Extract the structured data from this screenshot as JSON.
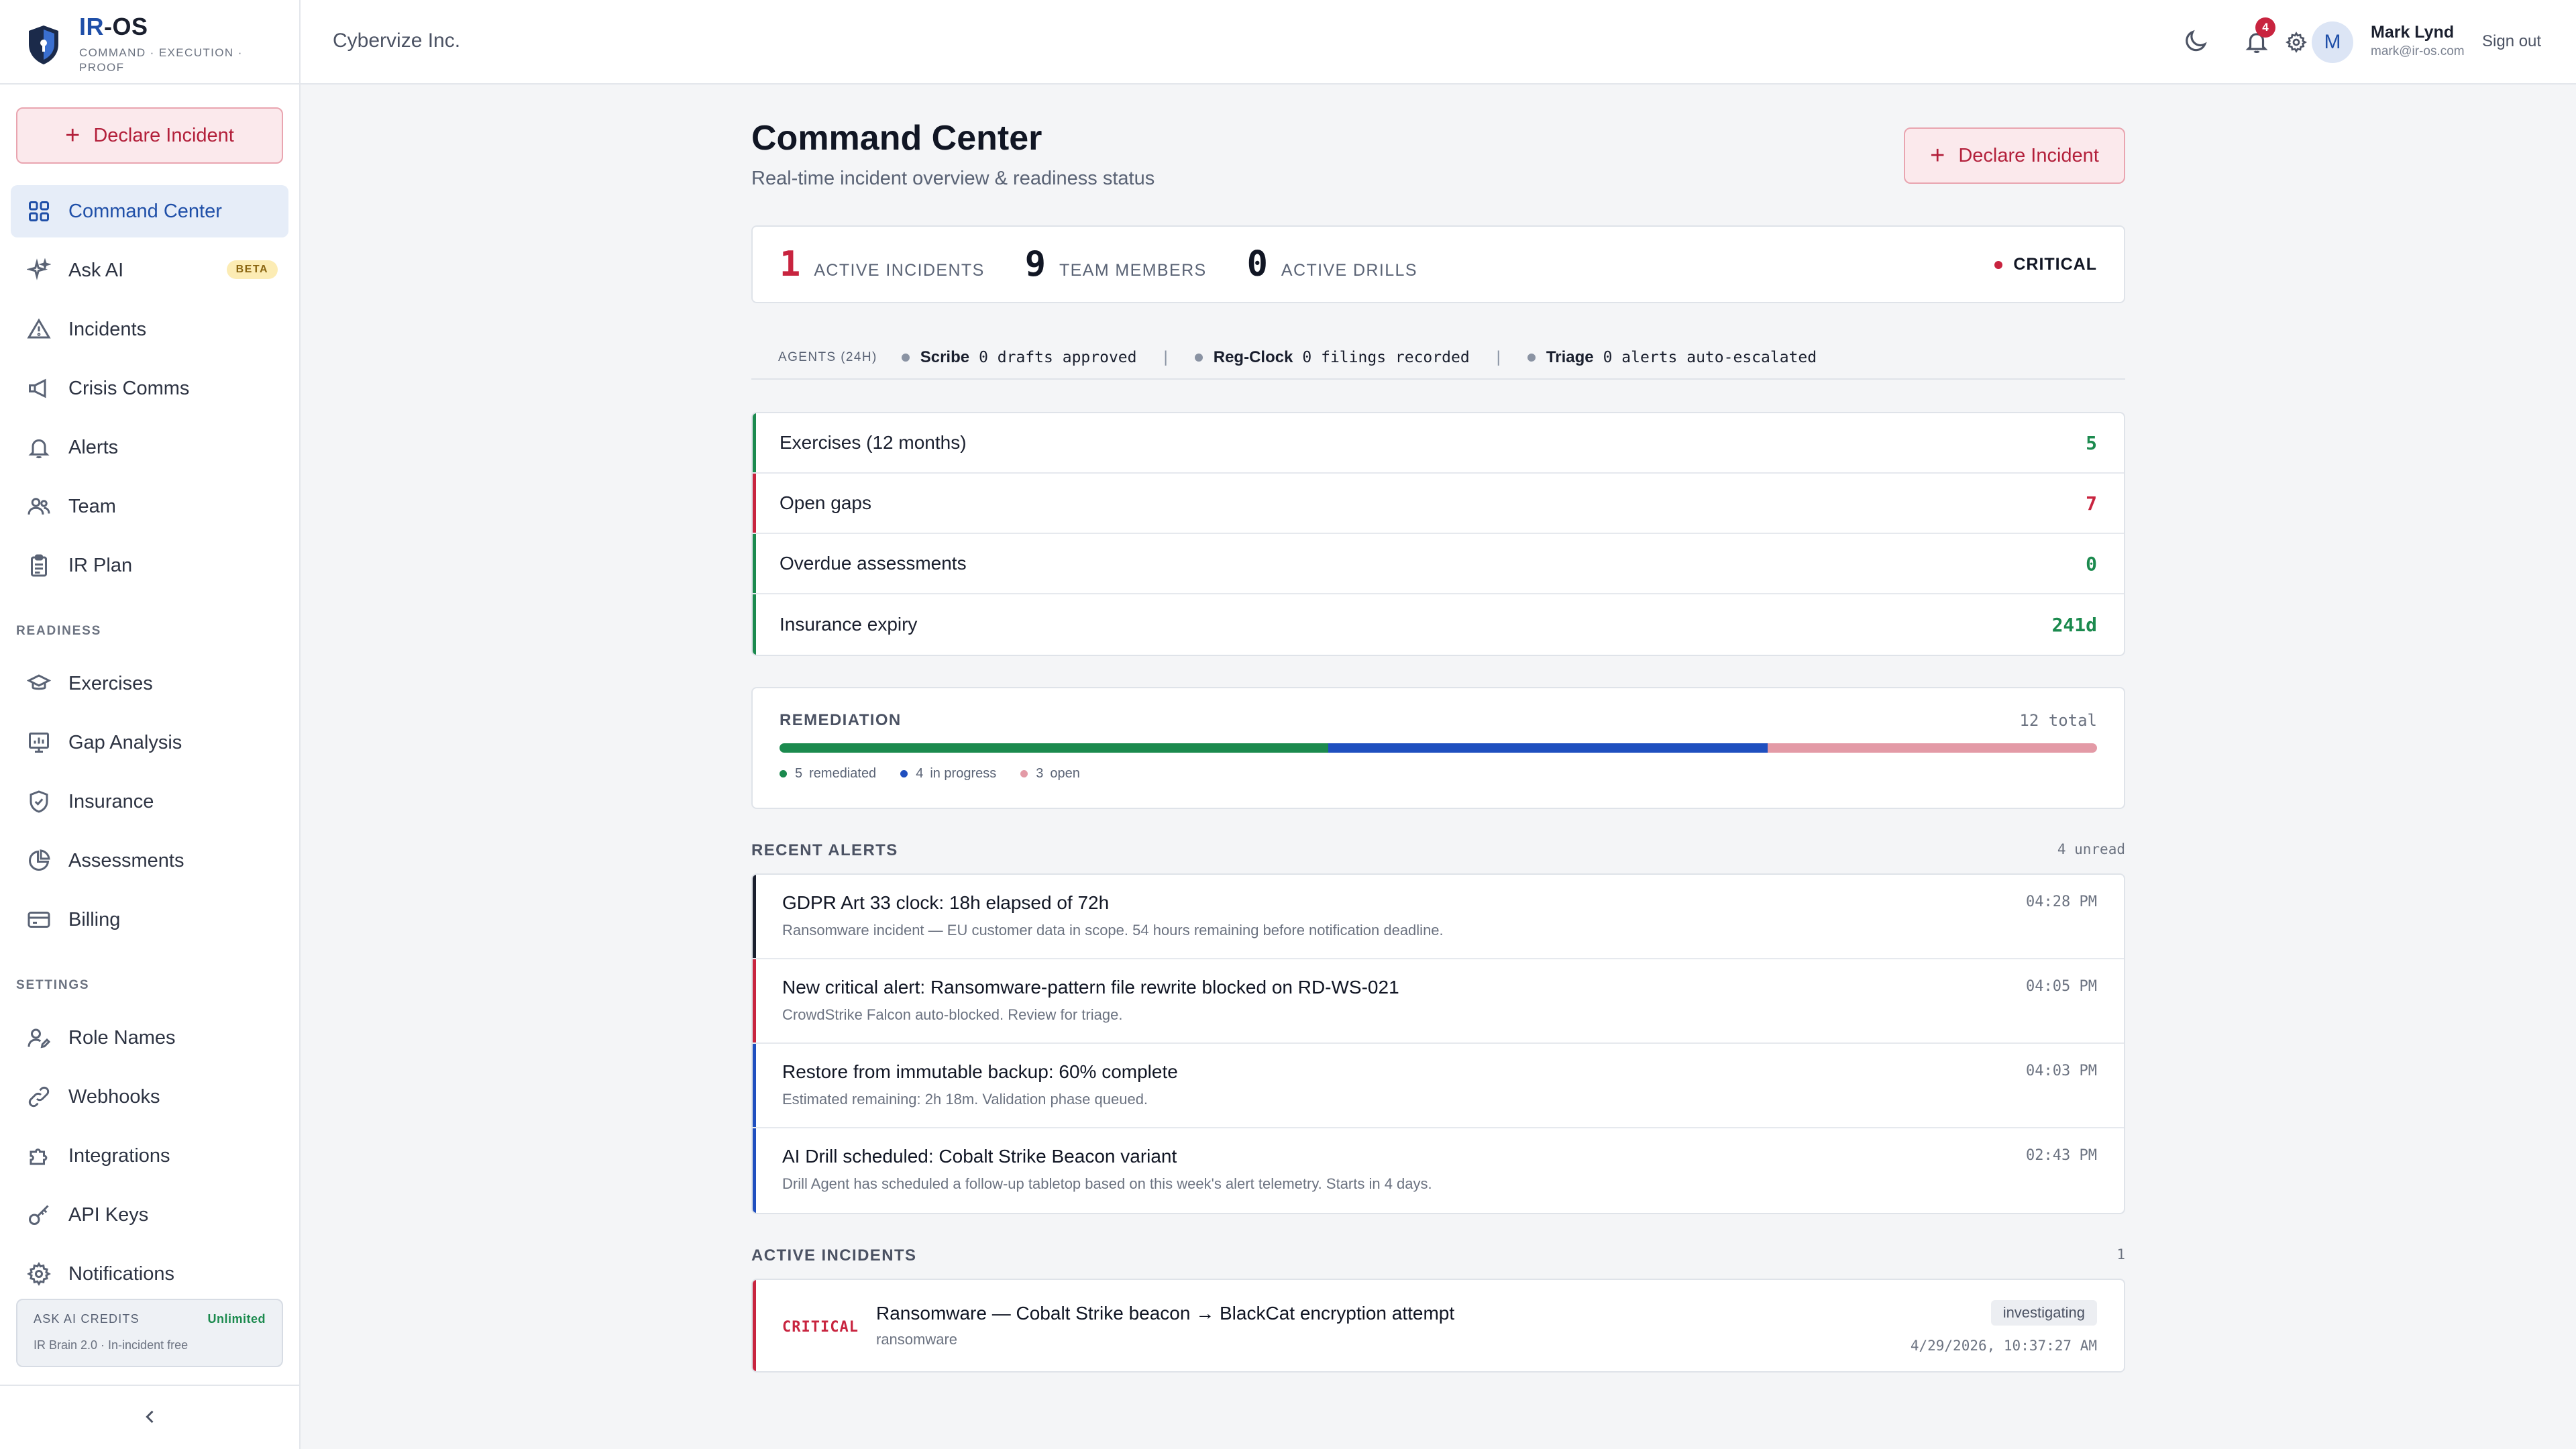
{
  "brand": {
    "name_prefix": "IR",
    "name_suffix": "-OS",
    "tagline": "COMMAND · EXECUTION · PROOF"
  },
  "sidebar": {
    "declare_label": "Declare Incident",
    "nav": [
      {
        "label": "Command Center",
        "icon": "grid-icon",
        "active": true
      },
      {
        "label": "Ask AI",
        "icon": "sparkle-icon",
        "badge": "BETA"
      },
      {
        "label": "Incidents",
        "icon": "warning-icon"
      },
      {
        "label": "Crisis Comms",
        "icon": "megaphone-icon"
      },
      {
        "label": "Alerts",
        "icon": "bell-icon"
      },
      {
        "label": "Team",
        "icon": "users-icon"
      },
      {
        "label": "IR Plan",
        "icon": "clipboard-icon"
      }
    ],
    "readiness_label": "READINESS",
    "readiness": [
      {
        "label": "Exercises",
        "icon": "graduation-cap-icon"
      },
      {
        "label": "Gap Analysis",
        "icon": "monitor-chart-icon"
      },
      {
        "label": "Insurance",
        "icon": "shield-check-icon"
      },
      {
        "label": "Assessments",
        "icon": "pie-chart-icon"
      },
      {
        "label": "Billing",
        "icon": "credit-card-icon"
      }
    ],
    "settings_label": "SETTINGS",
    "settings": [
      {
        "label": "Role Names",
        "icon": "user-edit-icon"
      },
      {
        "label": "Webhooks",
        "icon": "link-icon"
      },
      {
        "label": "Integrations",
        "icon": "puzzle-icon"
      },
      {
        "label": "API Keys",
        "icon": "key-icon"
      },
      {
        "label": "Notifications",
        "icon": "gear-icon"
      }
    ],
    "credits": {
      "label": "ASK AI CREDITS",
      "value": "Unlimited",
      "sub": "IR Brain 2.0 · In-incident free"
    }
  },
  "topbar": {
    "org": "Cybervize Inc.",
    "notif_count": "4",
    "user_initial": "M",
    "user_name": "Mark Lynd",
    "user_email": "mark@ir-os.com",
    "signout": "Sign out"
  },
  "page": {
    "title": "Command Center",
    "subtitle": "Real-time incident overview & readiness status",
    "declare_label": "Declare Incident"
  },
  "stats": {
    "active_incidents": "1",
    "active_incidents_label": "ACTIVE INCIDENTS",
    "team_members": "9",
    "team_members_label": "TEAM MEMBERS",
    "active_drills": "0",
    "active_drills_label": "ACTIVE DRILLS",
    "status": "CRITICAL"
  },
  "agents": {
    "label": "AGENTS (24H)",
    "items": [
      {
        "name": "Scribe",
        "desc": "0 drafts approved"
      },
      {
        "name": "Reg-Clock",
        "desc": "0 filings recorded"
      },
      {
        "name": "Triage",
        "desc": "0 alerts auto-escalated"
      }
    ]
  },
  "metrics": [
    {
      "label": "Exercises (12 months)",
      "value": "5",
      "color": "#1b8a4e"
    },
    {
      "label": "Open gaps",
      "value": "7",
      "color": "#c8243f"
    },
    {
      "label": "Overdue assessments",
      "value": "0",
      "color": "#1b8a4e"
    },
    {
      "label": "Insurance expiry",
      "value": "241d",
      "color": "#1b8a4e"
    }
  ],
  "remediation": {
    "title": "REMEDIATION",
    "total": "12 total",
    "segments": [
      {
        "count": 5,
        "count_label": "5",
        "label": "remediated",
        "color": "#1b8a4e"
      },
      {
        "count": 4,
        "count_label": "4",
        "label": "in progress",
        "color": "#1f4fbf"
      },
      {
        "count": 3,
        "count_label": "3",
        "label": "open",
        "color": "#e39aa6"
      }
    ]
  },
  "alerts": {
    "title": "RECENT ALERTS",
    "count": "4 unread",
    "items": [
      {
        "title": "GDPR Art 33 clock: 18h elapsed of 72h",
        "desc": "Ransomware incident — EU customer data in scope. 54 hours remaining before notification deadline.",
        "time": "04:28 PM",
        "color": "#1a1f2e"
      },
      {
        "title": "New critical alert: Ransomware-pattern file rewrite blocked on RD-WS-021",
        "desc": "CrowdStrike Falcon auto-blocked. Review for triage.",
        "time": "04:05 PM",
        "color": "#c8243f"
      },
      {
        "title": "Restore from immutable backup: 60% complete",
        "desc": "Estimated remaining: 2h 18m. Validation phase queued.",
        "time": "04:03 PM",
        "color": "#1f4fbf"
      },
      {
        "title": "AI Drill scheduled: Cobalt Strike Beacon variant",
        "desc": "Drill Agent has scheduled a follow-up tabletop based on this week's alert telemetry. Starts in 4 days.",
        "time": "02:43 PM",
        "color": "#1f4fbf"
      }
    ]
  },
  "incidents": {
    "title": "ACTIVE INCIDENTS",
    "count": "1",
    "items": [
      {
        "severity": "CRITICAL",
        "title": "Ransomware — Cobalt Strike beacon → BlackCat encryption attempt",
        "type": "ransomware",
        "status": "investigating",
        "date": "4/29/2026, 10:37:27 AM"
      }
    ]
  },
  "colors": {
    "accent": "#1f4fa8",
    "critical": "#c8243f",
    "good": "#1b8a4e"
  }
}
